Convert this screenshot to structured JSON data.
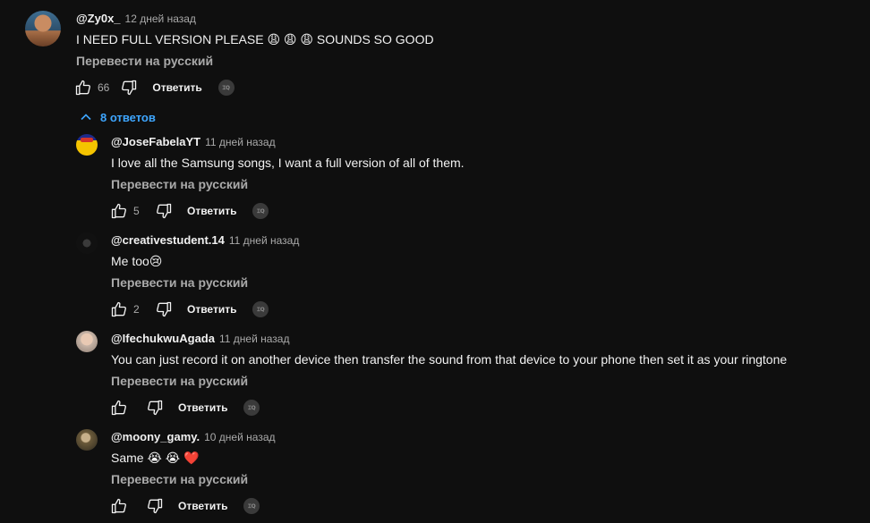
{
  "top_comment": {
    "author": "@Zy0x_",
    "time": "12 дней назад",
    "text": "I NEED FULL VERSION PLEASE 😩 😩 😩 SOUNDS SO GOOD",
    "translate": "Перевести на русский",
    "likes": "66",
    "reply_label": "Ответить"
  },
  "replies_toggle": {
    "label": "8 ответов"
  },
  "replies": [
    {
      "author": "@JoseFabelaYT",
      "time": "11 дней назад",
      "text": "I love all the Samsung songs, I want a full version of all of them.",
      "translate": "Перевести на русский",
      "likes": "5",
      "reply_label": "Ответить"
    },
    {
      "author": "@creativestudent.14",
      "time": "11 дней назад",
      "text": "Me too😢",
      "translate": "Перевести на русский",
      "likes": "2",
      "reply_label": "Ответить"
    },
    {
      "author": "@IfechukwuAgada",
      "time": "11 дней назад",
      "text": "You can just record it on another device then transfer the sound from that device to your phone then set it as your ringtone",
      "translate": "Перевести на русский",
      "likes": "",
      "reply_label": "Ответить"
    },
    {
      "author": "@moony_gamy.",
      "time": "10 дней назад",
      "text": "Same 😭 😭 ❤️",
      "translate": "Перевести на русский",
      "likes": "",
      "reply_label": "Ответить"
    }
  ],
  "icons": {
    "like": "thumbs-up-icon",
    "dislike": "thumbs-down-icon",
    "creator_heart": "creator-badge-icon",
    "collapse": "chevron-up-icon"
  },
  "colors": {
    "background": "#0f0f0f",
    "text": "#f1f1f1",
    "secondary": "#aaaaaa",
    "accent": "#3ea6ff"
  }
}
